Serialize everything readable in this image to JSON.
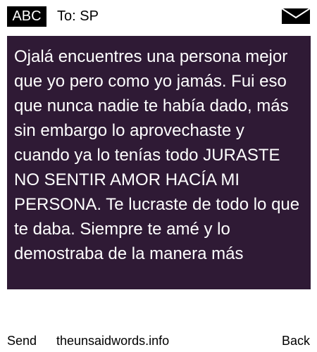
{
  "header": {
    "input_mode": "ABC",
    "recipient": "To: SP",
    "icon": "envelope-icon"
  },
  "message": {
    "text": "Ojalá encuentres una persona mejor que yo pero como yo jamás. Fui eso que nunca nadie te había dado, más sin embargo lo aprovechaste y cuando ya lo tenías todo JURASTE NO SENTIR AMOR HACÍA MI PERSONA. Te lucraste de todo lo que te daba. Siempre te amé y lo demostraba de la manera más"
  },
  "footer": {
    "left_softkey": "Send",
    "center_text": "theunsaidwords.info",
    "right_softkey": "Back"
  },
  "colors": {
    "message_background": "#2f1a35",
    "message_text": "#ffffff",
    "page_background": "#ffffff"
  }
}
